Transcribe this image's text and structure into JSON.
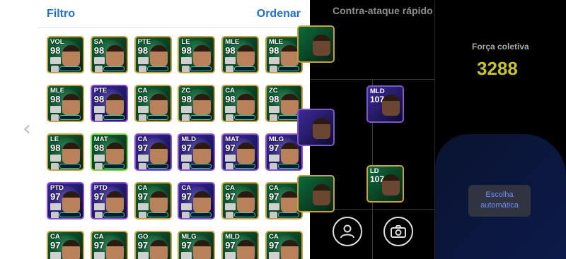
{
  "panel": {
    "filter_label": "Filtro",
    "sort_label": "Ordenar"
  },
  "nav": {
    "back_glyph": "‹"
  },
  "player_cards": [
    {
      "pos": "VOL",
      "ovr": "98",
      "style": "green"
    },
    {
      "pos": "SA",
      "ovr": "98",
      "style": "green"
    },
    {
      "pos": "PTE",
      "ovr": "98",
      "style": "green"
    },
    {
      "pos": "LE",
      "ovr": "98",
      "style": "green"
    },
    {
      "pos": "MLE",
      "ovr": "98",
      "style": "green"
    },
    {
      "pos": "MLE",
      "ovr": "98",
      "style": "green"
    },
    {
      "pos": "MLE",
      "ovr": "98",
      "style": "green"
    },
    {
      "pos": "PTE",
      "ovr": "98",
      "style": "purple"
    },
    {
      "pos": "CA",
      "ovr": "98",
      "style": "green"
    },
    {
      "pos": "ZC",
      "ovr": "98",
      "style": "green"
    },
    {
      "pos": "CA",
      "ovr": "98",
      "style": "green"
    },
    {
      "pos": "ZC",
      "ovr": "98",
      "style": "green"
    },
    {
      "pos": "LE",
      "ovr": "98",
      "style": "green"
    },
    {
      "pos": "MAT",
      "ovr": "98",
      "style": "lime"
    },
    {
      "pos": "CA",
      "ovr": "97",
      "style": "purple"
    },
    {
      "pos": "MLD",
      "ovr": "97",
      "style": "purple"
    },
    {
      "pos": "MAT",
      "ovr": "97",
      "style": "purple"
    },
    {
      "pos": "MLG",
      "ovr": "97",
      "style": "purple"
    },
    {
      "pos": "PTD",
      "ovr": "97",
      "style": "purple"
    },
    {
      "pos": "PTD",
      "ovr": "97",
      "style": "purple"
    },
    {
      "pos": "CA",
      "ovr": "97",
      "style": "green"
    },
    {
      "pos": "CA",
      "ovr": "97",
      "style": "purple"
    },
    {
      "pos": "CA",
      "ovr": "97",
      "style": "green"
    },
    {
      "pos": "CA",
      "ovr": "97",
      "style": "green"
    },
    {
      "pos": "CA",
      "ovr": "97",
      "style": "green"
    },
    {
      "pos": "CA",
      "ovr": "97",
      "style": "green"
    },
    {
      "pos": "GO",
      "ovr": "97",
      "style": "green"
    },
    {
      "pos": "MLG",
      "ovr": "97",
      "style": "green"
    },
    {
      "pos": "MLD",
      "ovr": "97",
      "style": "green"
    },
    {
      "pos": "CA",
      "ovr": "97",
      "style": "green"
    }
  ],
  "formation": {
    "title": "Contra-ataque rápido",
    "slots": [
      {
        "pos": "MLD",
        "ovr": "107",
        "style": "purple"
      },
      {
        "pos": "LD",
        "ovr": "107",
        "style": "green"
      }
    ]
  },
  "team": {
    "strength_label": "Força coletiva",
    "strength_value": "3288"
  },
  "auto_select": {
    "line1": "Escolha",
    "line2": "automática"
  },
  "icons": {
    "player_icon": "person-icon",
    "camera_icon": "camera-icon"
  },
  "colors": {
    "accent_blue": "#1e6fd9",
    "strength_yellow": "#c7c326",
    "card_gold_border": "#c9a13e",
    "card_purple_border": "#8a4dd6"
  }
}
